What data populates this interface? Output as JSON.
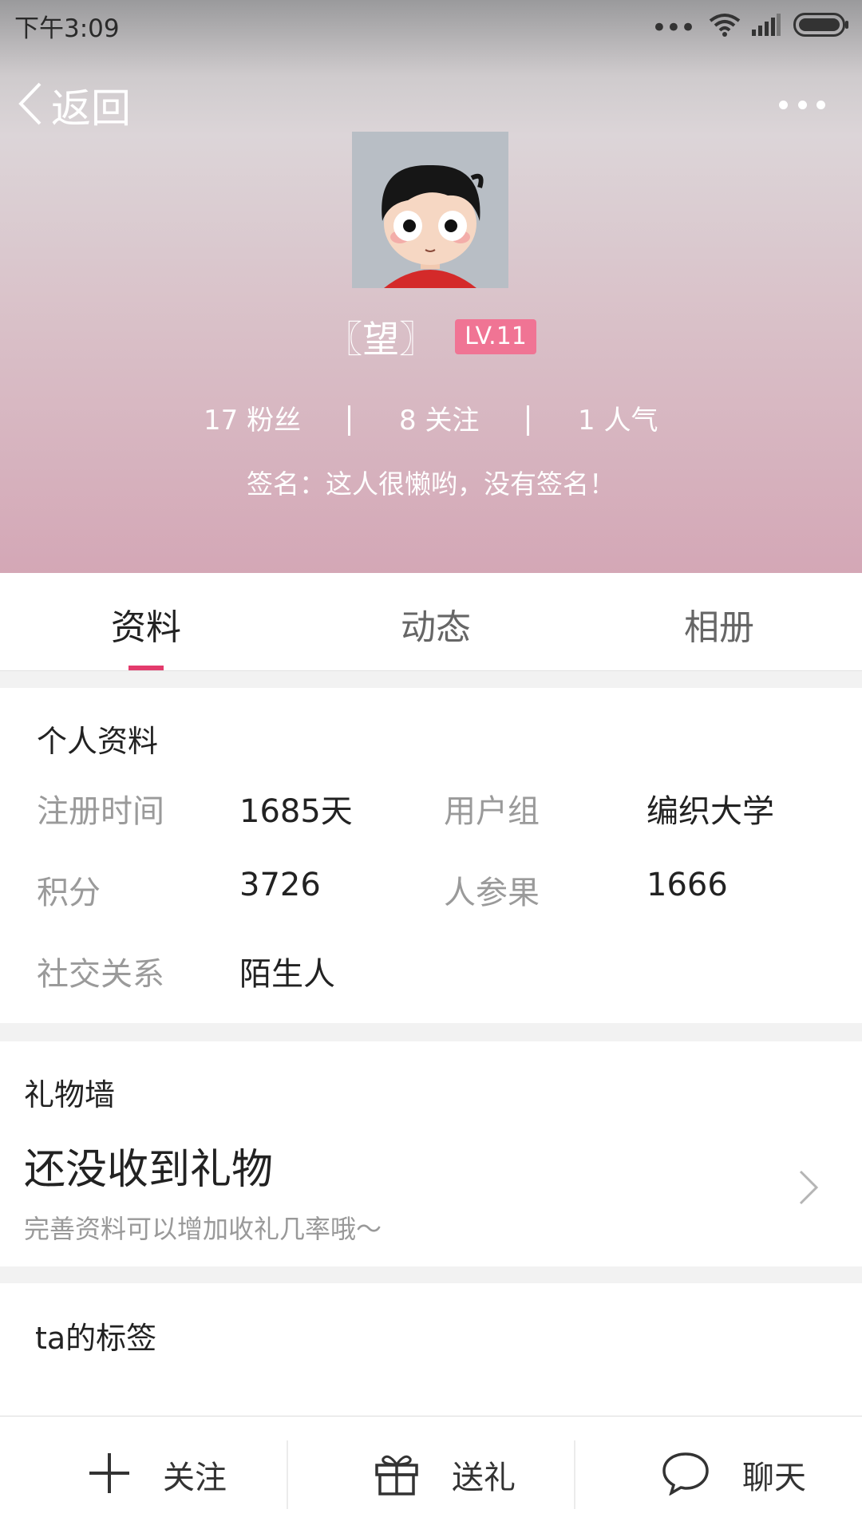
{
  "status_bar": {
    "time": "下午3:09",
    "icons": [
      "more-dots-icon",
      "wifi-icon",
      "signal-icon",
      "battery-icon"
    ]
  },
  "nav": {
    "back_label": "返回",
    "more_icon": "more-horizontal-icon"
  },
  "profile": {
    "avatar_icon": "cartoon-boy-avatar",
    "name": "〖望〗",
    "level": "LV.11",
    "stats": [
      {
        "label": "17 粉丝"
      },
      {
        "label": "8 关注"
      },
      {
        "label": "1 人气"
      }
    ],
    "signature": "签名：这人很懒哟，没有签名！"
  },
  "tabs": [
    {
      "label": "资料",
      "active": true
    },
    {
      "label": "动态",
      "active": false
    },
    {
      "label": "相册",
      "active": false
    }
  ],
  "personal_info": {
    "title": "个人资料",
    "fields": [
      {
        "label": "注册时间",
        "value": "1685天"
      },
      {
        "label": "用户组",
        "value": "编织大学"
      },
      {
        "label": "积分",
        "value": "3726"
      },
      {
        "label": "人参果",
        "value": "1666"
      },
      {
        "label": "社交关系",
        "value": "陌生人"
      }
    ]
  },
  "gift_wall": {
    "title": "礼物墙",
    "empty_text": "还没收到礼物",
    "hint": "完善资料可以增加收礼几率哦～"
  },
  "tags": {
    "title": "ta的标签"
  },
  "bottom_bar": [
    {
      "icon": "plus-icon",
      "label": "关注"
    },
    {
      "icon": "gift-icon",
      "label": "送礼"
    },
    {
      "icon": "chat-bubble-icon",
      "label": "聊天"
    }
  ],
  "colors": {
    "accent": "#e33b6c",
    "level_badge": "#f07494"
  }
}
